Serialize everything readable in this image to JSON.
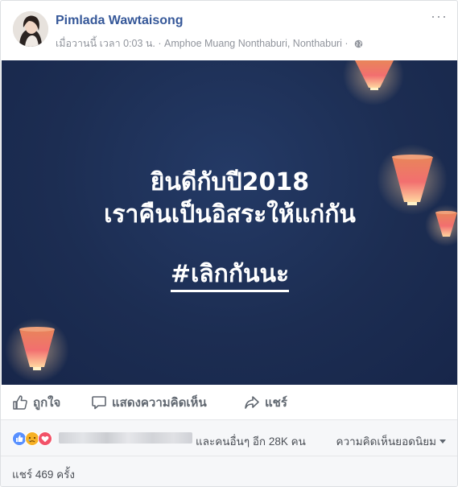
{
  "post": {
    "author": "Pimlada Wawtaisong",
    "meta": "เมื่อวานนี้ เวลา 0:03 น. · Amphoe Muang Nonthaburi, Nonthaburi ·",
    "more": "···"
  },
  "image": {
    "line1": "ยินดีกับปี2018",
    "line2": "เราคืนเป็นอิสระให้แก่กัน",
    "line3": "#เลิกกันนะ"
  },
  "actions": {
    "like": "ถูกใจ",
    "comment": "แสดงความคิดเห็น",
    "share": "แชร์"
  },
  "reactions": {
    "text": "และคนอื่นๆ อีก 28K คน",
    "sort": "ความคิดเห็นยอดนิยม",
    "icons": [
      "like-icon",
      "sad-icon",
      "love-icon"
    ],
    "colors": {
      "like": "#5890ff",
      "sad": "#f7b125",
      "love": "#f25268"
    }
  },
  "shares": "แชร์ 469 ครั้ง",
  "colors": {
    "author": "#365899",
    "background": "#1c2d52",
    "meta": "#90949c"
  }
}
